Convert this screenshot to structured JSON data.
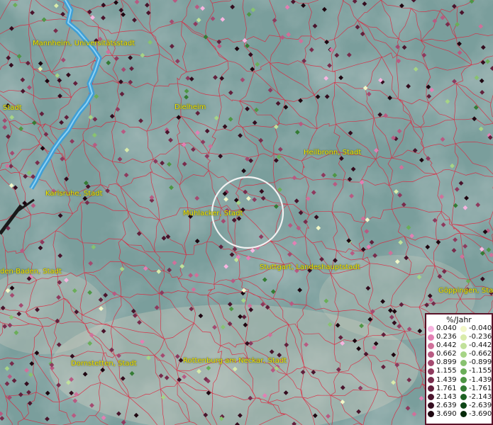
{
  "map": {
    "cities": [
      {
        "name": "Mannheim, Universitätsstadt"
      },
      {
        "name": "Stadt"
      },
      {
        "name": "Dielheim"
      },
      {
        "name": "Heilbronn, Stadt"
      },
      {
        "name": "Karlsruhe, Stadt"
      },
      {
        "name": "Mühlacker, Stadt"
      },
      {
        "name": "den-Baden, Stadt"
      },
      {
        "name": "Stuttgart, Landeshauptstadt"
      },
      {
        "name": "Göppingen, Stadt"
      },
      {
        "name": "Dornstetten, Stadt"
      },
      {
        "name": "Rottenburg am Neckar, Stadt"
      }
    ],
    "colors": {
      "river": "#3f9fd6",
      "boundaries": "#e0203a",
      "terrain": "#7a9e9c",
      "legend_border": "#5a1228"
    }
  },
  "legend": {
    "title": "%/Jahr",
    "positive": [
      {
        "label": "0.040",
        "color": "#f7b4e0"
      },
      {
        "label": "0.236",
        "color": "#e37fb4"
      },
      {
        "label": "0.442",
        "color": "#d0709a"
      },
      {
        "label": "0.662",
        "color": "#b85a82"
      },
      {
        "label": "0.899",
        "color": "#a44a70"
      },
      {
        "label": "1.155",
        "color": "#8e3a5e"
      },
      {
        "label": "1.439",
        "color": "#782c4c"
      },
      {
        "label": "1.761",
        "color": "#62203c"
      },
      {
        "label": "2.143",
        "color": "#4a142c"
      },
      {
        "label": "2.639",
        "color": "#340c1e"
      },
      {
        "label": "3.690",
        "color": "#1e0610"
      }
    ],
    "negative": [
      {
        "label": "-0.040",
        "color": "#f2f7c8"
      },
      {
        "label": "-0.236",
        "color": "#d9ebaa"
      },
      {
        "label": "-0.442",
        "color": "#c1e19a"
      },
      {
        "label": "-0.662",
        "color": "#a6d486"
      },
      {
        "label": "-0.899",
        "color": "#88c270"
      },
      {
        "label": "-1.155",
        "color": "#6aae58"
      },
      {
        "label": "-1.439",
        "color": "#4e9644"
      },
      {
        "label": "-1.761",
        "color": "#347c34"
      },
      {
        "label": "-2.143",
        "color": "#1e6224"
      },
      {
        "label": "-2.639",
        "color": "#0e4616"
      },
      {
        "label": "-3.690",
        "color": "#062a0a"
      }
    ]
  }
}
